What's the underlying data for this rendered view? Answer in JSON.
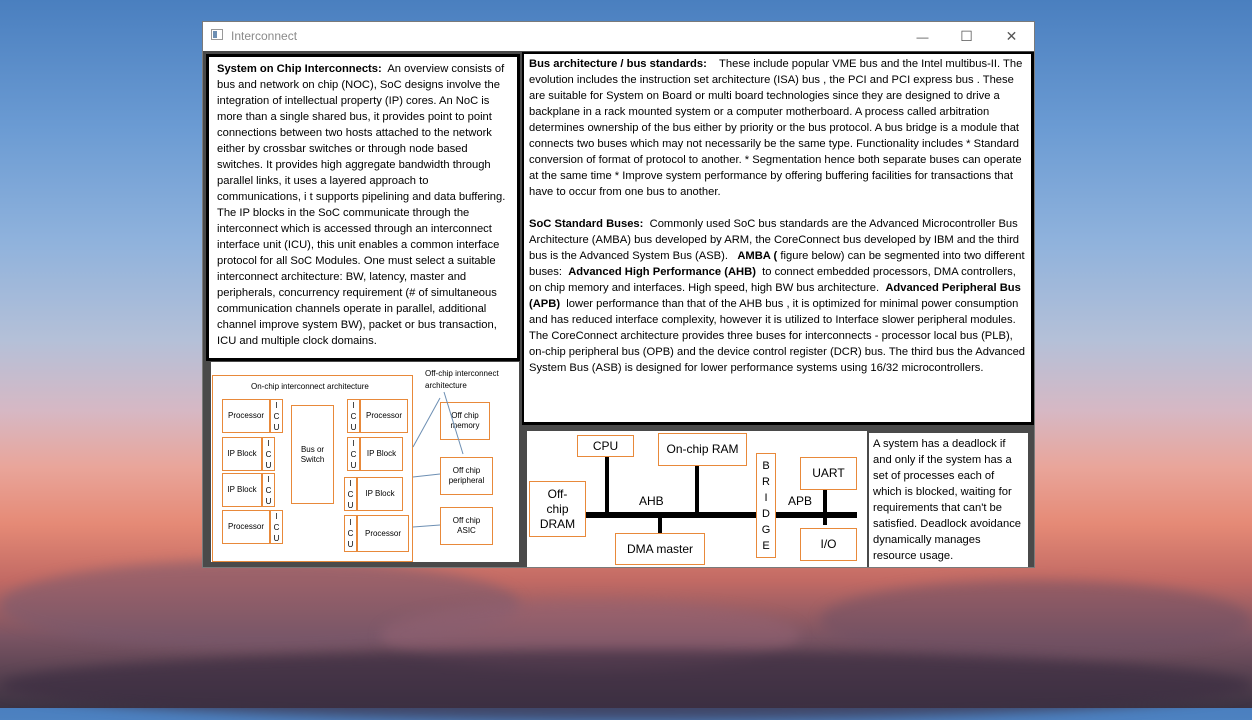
{
  "window": {
    "title": "Interconnect"
  },
  "controls": {
    "minimize": "—",
    "maximize": "☐",
    "close": "✕"
  },
  "soc": {
    "heading": "System on Chip Interconnects:",
    "body": "An overview consists of bus and network on chip (NOC), SoC designs involve the integration of intellectual property (IP) cores.  An NoC is more than a single shared bus, it provides point to point connections between two hosts attached to the network either by crossbar switches or through node based switches. It provides high aggregate bandwidth through parallel links, it uses a layered approach to communications, i t supports pipelining and data buffering. The IP blocks in the SoC communicate through the interconnect which is accessed through an interconnect interface unit (ICU), this unit enables a common interface protocol for all SoC Modules.  One must select a suitable interconnect architecture: BW, latency, master and peripherals, concurrency requirement (# of simultaneous communication channels operate in parallel, additional channel improve system BW), packet or bus transaction, ICU and multiple clock domains."
  },
  "bus": {
    "heading": "Bus architecture / bus standards:",
    "body": "These include popular VME bus and the Intel multibus-II. The evolution includes the instruction set architecture (ISA) bus , the PCI and PCI express bus . These are suitable for System on Board or multi board technologies since they are designed to drive a backplane in a rack mounted system or a computer motherboard. A process called arbitration determines ownership of the bus either by priority or the bus protocol.  A bus bridge is a module that connects two buses which may not necessarily be the same type. Functionality includes * Standard conversion of format of protocol to another. * Segmentation hence both separate buses can operate at the same time * Improve system performance by offering buffering facilities for transactions that have to occur from one bus to another."
  },
  "std": {
    "heading": "SoC Standard Buses:",
    "p1": "Commonly used SoC bus standards are the Advanced Microcontroller Bus Architecture (AMBA) bus developed by ARM, the CoreConnect bus developed by IBM and the third bus is the Advanced System Bus (ASB).",
    "amba": "AMBA (",
    "p2": "figure below)   can be segmented into two different buses:",
    "ahb": "Advanced High Performance (AHB)",
    "p3": "to connect embedded processors, DMA controllers, on chip memory and interfaces. High speed, high BW bus architecture.",
    "apb": "Advanced Peripheral Bus (APB)",
    "p4": "lower performance than that of the AHB bus , it is optimized for minimal power consumption and has reduced interface complexity, however it is utilized to  Interface slower peripheral modules. The CoreConnect architecture provides three buses for interconnects - processor local bus (PLB), on-chip peripheral bus (OPB) and the device control register (DCR) bus. The third bus the Advanced System Bus (ASB) is designed for lower performance systems using 16/32 microcontrollers."
  },
  "deadlock": {
    "text": "A system has a deadlock if and only if the system has a set of processes each of which is blocked, waiting for requirements that can't be satisfied. Deadlock avoidance dynamically manages resource usage."
  },
  "diagram_left": {
    "onchip_title": "On-chip interconnect architecture",
    "offchip_title_1": "Off-chip interconnect",
    "offchip_title_2": "architecture",
    "processor": "Processor",
    "ip_block": "IP Block",
    "bus_switch_1": "Bus or",
    "bus_switch_2": "Switch",
    "icu": [
      "I",
      "C",
      "U"
    ],
    "off_mem_1": "Off chip",
    "off_mem_2": "memory",
    "off_per_1": "Off chip",
    "off_per_2": "peripheral",
    "off_asic_1": "Off chip",
    "off_asic_2": "ASIC"
  },
  "diagram_right": {
    "cpu": "CPU",
    "ram": "On-chip RAM",
    "dram_1": "Off-",
    "dram_2": "chip",
    "dram_3": "DRAM",
    "ahb": "AHB",
    "dma": "DMA master",
    "bridge": [
      "B",
      "R",
      "I",
      "D",
      "G",
      "E"
    ],
    "apb": "APB",
    "uart": "UART",
    "io": "I/O"
  },
  "colors": {
    "box_border": "#e8893a",
    "panel_bg": "#ffffff",
    "window_bg": "#4a4a4a"
  }
}
